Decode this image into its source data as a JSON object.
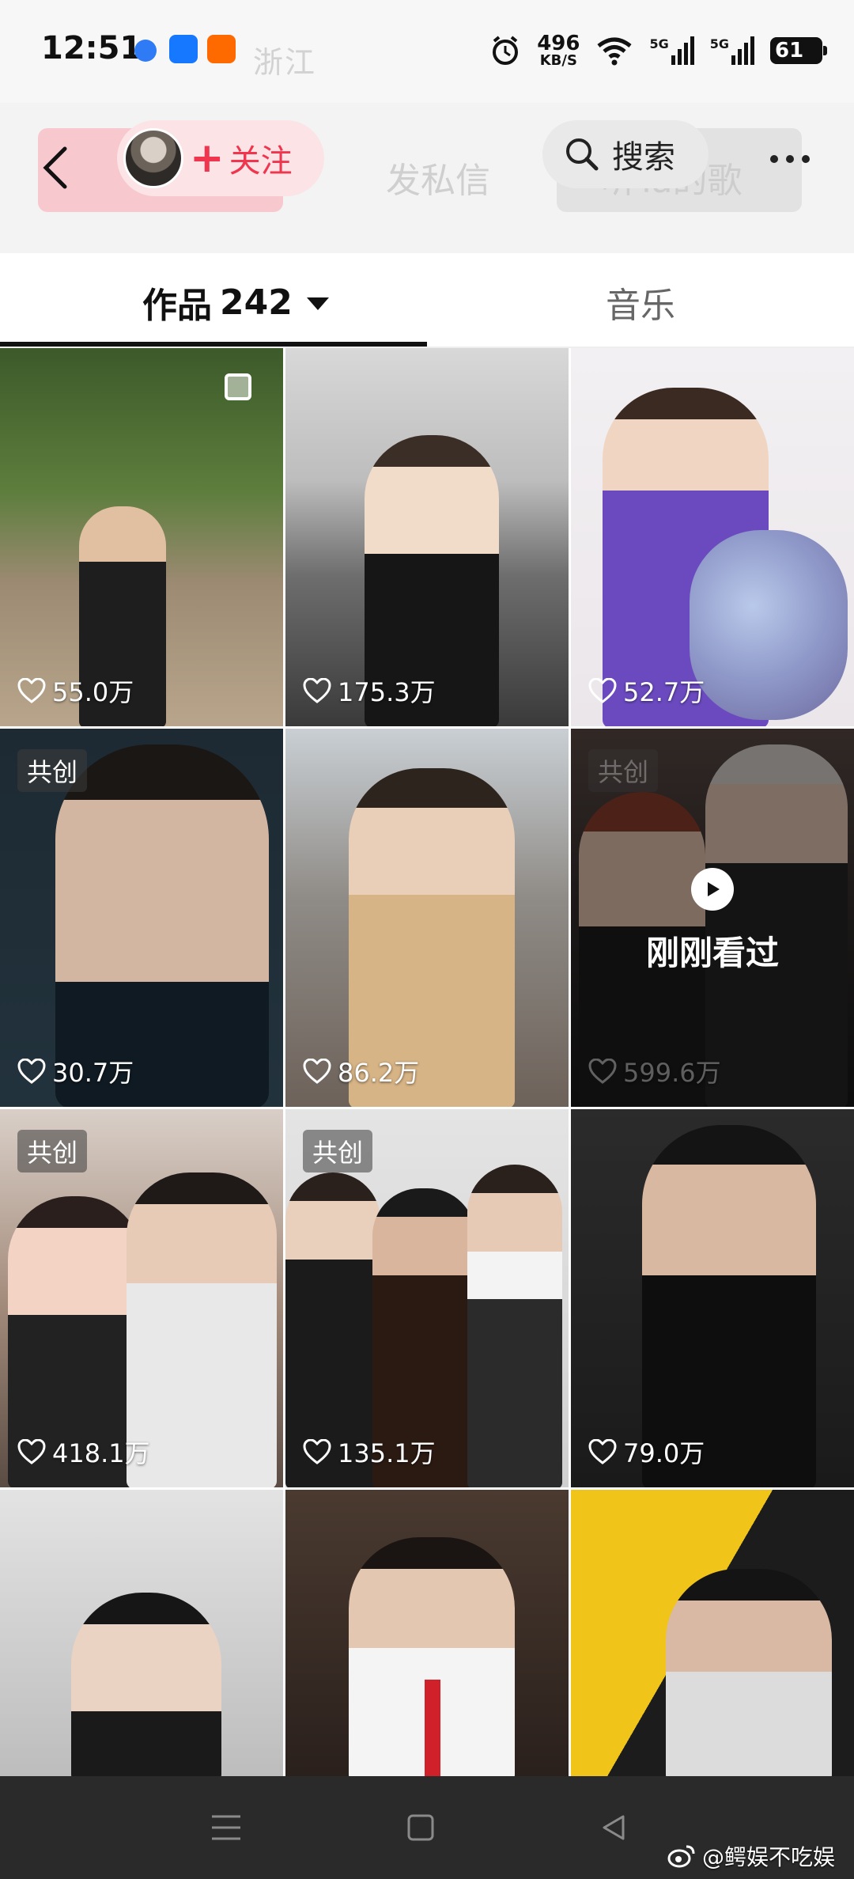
{
  "status_bar": {
    "time": "12:51",
    "ghost_location": "浙江",
    "net_speed_value": "496",
    "net_speed_unit": "KB/S",
    "signal_1": "5G",
    "signal_2": "5G",
    "battery": "61"
  },
  "header": {
    "follow_label": "关注",
    "ghost_message": "发私信",
    "ghost_song": "听Ta的歌",
    "search_label": "搜索"
  },
  "tabs": {
    "works_label": "作品",
    "works_count": "242",
    "music_label": "音乐"
  },
  "grid": {
    "badge_label": "共创",
    "seen_label": "刚刚看过",
    "items": [
      {
        "likes": "55.0万"
      },
      {
        "likes": "175.3万"
      },
      {
        "likes": "52.7万"
      },
      {
        "likes": "30.7万"
      },
      {
        "likes": "86.2万"
      },
      {
        "likes": "599.6万"
      },
      {
        "likes": "418.1万"
      },
      {
        "likes": "135.1万"
      },
      {
        "likes": "79.0万"
      },
      {
        "likes": ""
      },
      {
        "likes": ""
      },
      {
        "likes": ""
      }
    ]
  },
  "watermark": "@鳄娱不吃娱",
  "colors": {
    "accent": "#f0354f",
    "navbar": "#2a2a2a"
  }
}
